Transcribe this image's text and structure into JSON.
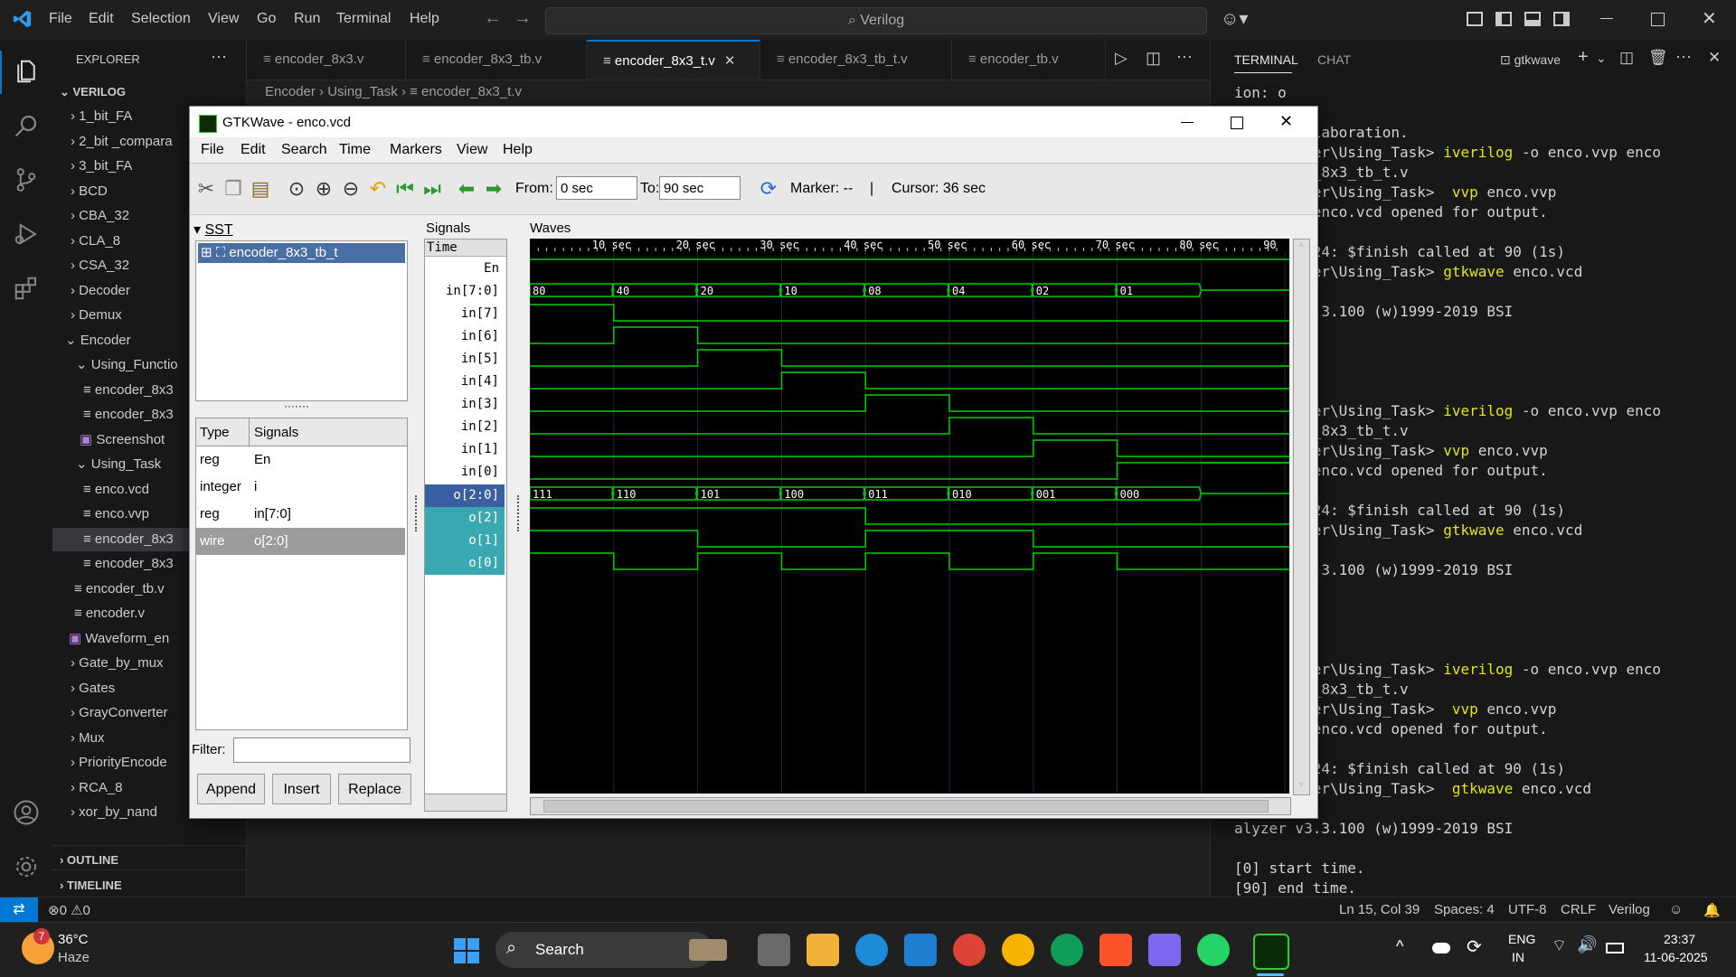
{
  "vscode": {
    "menu": [
      "File",
      "Edit",
      "Selection",
      "View",
      "Go",
      "Run",
      "Terminal",
      "Help"
    ],
    "command_center": "Verilog",
    "explorer": {
      "title": "EXPLORER",
      "root": "VERILOG",
      "items": [
        {
          "label": "1_bit_FA",
          "kind": "folder"
        },
        {
          "label": "2_bit _compara",
          "kind": "folder"
        },
        {
          "label": "3_bit_FA",
          "kind": "folder"
        },
        {
          "label": "BCD",
          "kind": "folder"
        },
        {
          "label": "CBA_32",
          "kind": "folder"
        },
        {
          "label": "CLA_8",
          "kind": "folder"
        },
        {
          "label": "CSA_32",
          "kind": "folder"
        },
        {
          "label": "Decoder",
          "kind": "folder"
        },
        {
          "label": "Demux",
          "kind": "folder"
        },
        {
          "label": "Encoder",
          "kind": "folder-open"
        },
        {
          "label": "Using_Functio",
          "kind": "folder-open"
        },
        {
          "label": "encoder_8x3",
          "kind": "file"
        },
        {
          "label": "encoder_8x3",
          "kind": "file"
        },
        {
          "label": "Screenshot",
          "kind": "image"
        },
        {
          "label": "Using_Task",
          "kind": "folder-open"
        },
        {
          "label": "enco.vcd",
          "kind": "file"
        },
        {
          "label": "enco.vvp",
          "kind": "file"
        },
        {
          "label": "encoder_8x3",
          "kind": "file"
        },
        {
          "label": "encoder_8x3",
          "kind": "file"
        },
        {
          "label": "encoder_tb.v",
          "kind": "file"
        },
        {
          "label": "encoder.v",
          "kind": "file"
        },
        {
          "label": "Waveform_en",
          "kind": "image"
        },
        {
          "label": "Gate_by_mux",
          "kind": "folder"
        },
        {
          "label": "Gates",
          "kind": "folder"
        },
        {
          "label": "GrayConverter",
          "kind": "folder"
        },
        {
          "label": "Mux",
          "kind": "folder"
        },
        {
          "label": "PriorityEncode",
          "kind": "folder"
        },
        {
          "label": "RCA_8",
          "kind": "folder"
        },
        {
          "label": "xor_by_nand",
          "kind": "folder"
        }
      ],
      "outline": "OUTLINE",
      "timeline": "TIMELINE"
    },
    "tabs": [
      "encoder_8x3.v",
      "encoder_8x3_tb.v",
      "encoder_8x3_t.v",
      "encoder_8x3_tb_t.v",
      "encoder_tb.v"
    ],
    "active_tab": "encoder_8x3_t.v",
    "breadcrumb": [
      "Encoder",
      "Using_Task",
      "encoder_8x3_t.v"
    ],
    "panel_tabs": [
      "TERMINAL",
      "CHAT"
    ],
    "terminal_name": "gtkwave",
    "terminal_lines": [
      {
        "pre": "ion: o",
        "cmd": "",
        "post": ""
      },
      {
        "pre": "",
        "cmd": "",
        "post": ""
      },
      {
        "pre": " during elaboration.",
        "cmd": "",
        "post": ""
      },
      {
        "pre": "log\\Encoder\\Using_Task> ",
        "cmd": "iverilog",
        "post": " -o enco.vvp enco"
      },
      {
        "pre": "/ encoder_8x3_tb_t.v",
        "cmd": "",
        "post": ""
      },
      {
        "pre": "log\\Encoder\\Using_Task>  ",
        "cmd": "vvp",
        "post": " enco.vvp"
      },
      {
        "pre": "dumpfile enco.vcd opened for output.",
        "cmd": "",
        "post": ""
      },
      {
        "pre": "",
        "cmd": "",
        "post": ""
      },
      {
        "pre": "3_tb_t.v:24: $finish called at 90 (1s)",
        "cmd": "",
        "post": ""
      },
      {
        "pre": "log\\Encoder\\Using_Task> ",
        "cmd": "gtkwave",
        "post": " enco.vcd"
      },
      {
        "pre": "",
        "cmd": "",
        "post": ""
      },
      {
        "pre": "alyzer v3.3.100 (w)1999-2019 BSI",
        "cmd": "",
        "post": ""
      },
      {
        "pre": "",
        "cmd": "",
        "post": ""
      },
      {
        "pre": "time.",
        "cmd": "",
        "post": ""
      },
      {
        "pre": "ime.",
        "cmd": "",
        "post": ""
      },
      {
        "pre": "",
        "cmd": "",
        "post": ""
      },
      {
        "pre": "log\\Encoder\\Using_Task> ",
        "cmd": "iverilog",
        "post": " -o enco.vvp enco"
      },
      {
        "pre": "/ encoder_8x3_tb_t.v",
        "cmd": "",
        "post": ""
      },
      {
        "pre": "log\\Encoder\\Using_Task> ",
        "cmd": "vvp",
        "post": " enco.vvp"
      },
      {
        "pre": "dumpfile enco.vcd opened for output.",
        "cmd": "",
        "post": ""
      },
      {
        "pre": "",
        "cmd": "",
        "post": ""
      },
      {
        "pre": "3_tb_t.v:24: $finish called at 90 (1s)",
        "cmd": "",
        "post": ""
      },
      {
        "pre": "log\\Encoder\\Using_Task> ",
        "cmd": "gtkwave",
        "post": " enco.vcd"
      },
      {
        "pre": "",
        "cmd": "",
        "post": ""
      },
      {
        "pre": "alyzer v3.3.100 (w)1999-2019 BSI",
        "cmd": "",
        "post": ""
      },
      {
        "pre": "",
        "cmd": "",
        "post": ""
      },
      {
        "pre": "time.",
        "cmd": "",
        "post": ""
      },
      {
        "pre": "ime.",
        "cmd": "",
        "post": ""
      },
      {
        "pre": "",
        "cmd": "",
        "post": ""
      },
      {
        "pre": "log\\Encoder\\Using_Task> ",
        "cmd": "iverilog",
        "post": " -o enco.vvp enco"
      },
      {
        "pre": "/ encoder_8x3_tb_t.v",
        "cmd": "",
        "post": ""
      },
      {
        "pre": "log\\Encoder\\Using_Task>  ",
        "cmd": "vvp",
        "post": " enco.vvp"
      },
      {
        "pre": "dumpfile enco.vcd opened for output.",
        "cmd": "",
        "post": ""
      },
      {
        "pre": "",
        "cmd": "",
        "post": ""
      },
      {
        "pre": "3_tb_t.v:24: $finish called at 90 (1s)",
        "cmd": "",
        "post": ""
      },
      {
        "pre": "log\\Encoder\\Using_Task>  ",
        "cmd": "gtkwave",
        "post": " enco.vcd"
      },
      {
        "pre": "",
        "cmd": "",
        "post": ""
      },
      {
        "pre": "alyzer v3.3.100 (w)1999-2019 BSI",
        "cmd": "",
        "post": ""
      },
      {
        "pre": "",
        "cmd": "",
        "post": ""
      },
      {
        "pre": "[0] start time.",
        "cmd": "",
        "post": ""
      },
      {
        "pre": "[90] end time.",
        "cmd": "",
        "post": ""
      }
    ],
    "status": {
      "errors": "0",
      "warnings": "0",
      "position": "Ln 15, Col 39",
      "spaces": "Spaces: 4",
      "encoding": "UTF-8",
      "eol": "CRLF",
      "language": "Verilog"
    }
  },
  "gtkwave": {
    "title": "GTKWave - enco.vcd",
    "menu": [
      "File",
      "Edit",
      "Search",
      "Time",
      "Markers",
      "View",
      "Help"
    ],
    "from_label": "From:",
    "from_value": "0 sec",
    "to_label": "To:",
    "to_value": "90 sec",
    "marker": "Marker: --",
    "separator": "|",
    "cursor": "Cursor: 36 sec",
    "sst_label": "SST",
    "sst_root": "encoder_8x3_tb_t",
    "type_header": "Type",
    "signals_header": "Signals",
    "vars": [
      {
        "type": "reg",
        "name": "En"
      },
      {
        "type": "integer",
        "name": "i"
      },
      {
        "type": "reg",
        "name": "in[7:0]"
      },
      {
        "type": "wire",
        "name": "o[2:0]"
      }
    ],
    "filter_label": "Filter:",
    "buttons": [
      "Append",
      "Insert",
      "Replace"
    ],
    "signals_pane_label": "Signals",
    "waves_pane_label": "Waves",
    "time_label": "Time",
    "signal_rows": [
      "En",
      "in[7:0]",
      "in[7]",
      "in[6]",
      "in[5]",
      "in[4]",
      "in[3]",
      "in[2]",
      "in[1]",
      "in[0]",
      "o[2:0]",
      "o[2]",
      "o[1]",
      "o[0]"
    ],
    "time_ticks": [
      "10 sec",
      "20 sec",
      "30 sec",
      "40 sec",
      "50 sec",
      "60 sec",
      "70 sec",
      "80 sec",
      "90"
    ],
    "bus_in": [
      "80",
      "40",
      "20",
      "10",
      "08",
      "04",
      "02",
      "01"
    ],
    "bus_out": [
      "111",
      "110",
      "101",
      "100",
      "011",
      "010",
      "001",
      "000"
    ],
    "o2_bits": [
      1,
      1,
      1,
      1,
      0,
      0,
      0,
      0
    ],
    "o1_bits": [
      1,
      1,
      0,
      0,
      1,
      1,
      0,
      0
    ],
    "o0_bits": [
      1,
      0,
      1,
      0,
      1,
      0,
      1,
      0
    ],
    "wave_color": "#00d000"
  },
  "taskbar": {
    "weather_temp": "36°C",
    "weather_desc": "Haze",
    "weather_badge": "7",
    "search": "Search",
    "lang": "ENG",
    "region": "IN",
    "time": "23:37",
    "date": "11-06-2025"
  }
}
